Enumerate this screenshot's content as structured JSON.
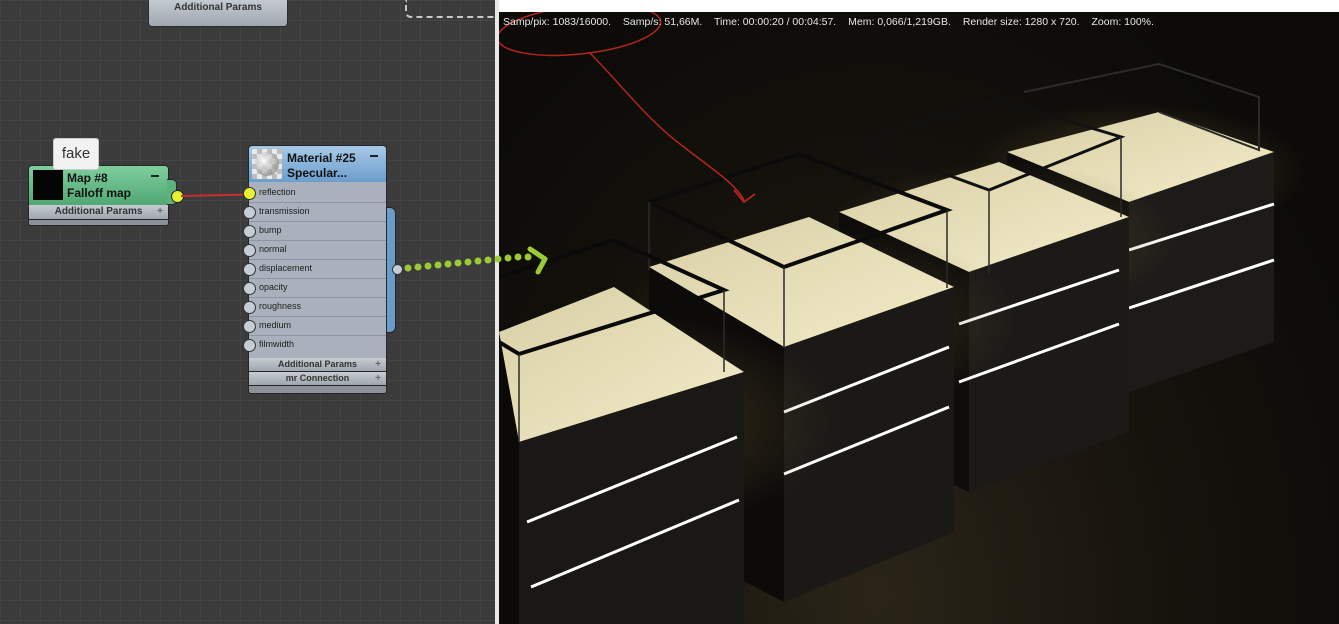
{
  "editor": {
    "top_stub_label": "Additional Params",
    "tooltip": "fake",
    "map_node": {
      "title_line1": "Map #8",
      "title_line2": "Falloff map",
      "footer": "Additional Params"
    },
    "material_node": {
      "title_line1": "Material #25",
      "title_line2": "Specular...",
      "slots": [
        "reflection",
        "transmission",
        "bump",
        "normal",
        "displacement",
        "opacity",
        "roughness",
        "medium",
        "filmwidth"
      ],
      "active_slot": "reflection",
      "footers": [
        "Additional Params",
        "mr Connection"
      ]
    }
  },
  "render": {
    "status": [
      "Samp/pix: 1083/16000.",
      "Samp/s: 51,66M.",
      "Time: 00:00:20 / 00:04:57.",
      "Mem: 0,066/1,219GB.",
      "Render size: 1280 x 720.",
      "Zoom: 100%."
    ]
  },
  "colors": {
    "map_node": "#4fa773",
    "material_node": "#6a9ccb",
    "wire": "#c72f2f",
    "dotted_arrow": "#9acb34",
    "annotation": "#b3261e"
  }
}
